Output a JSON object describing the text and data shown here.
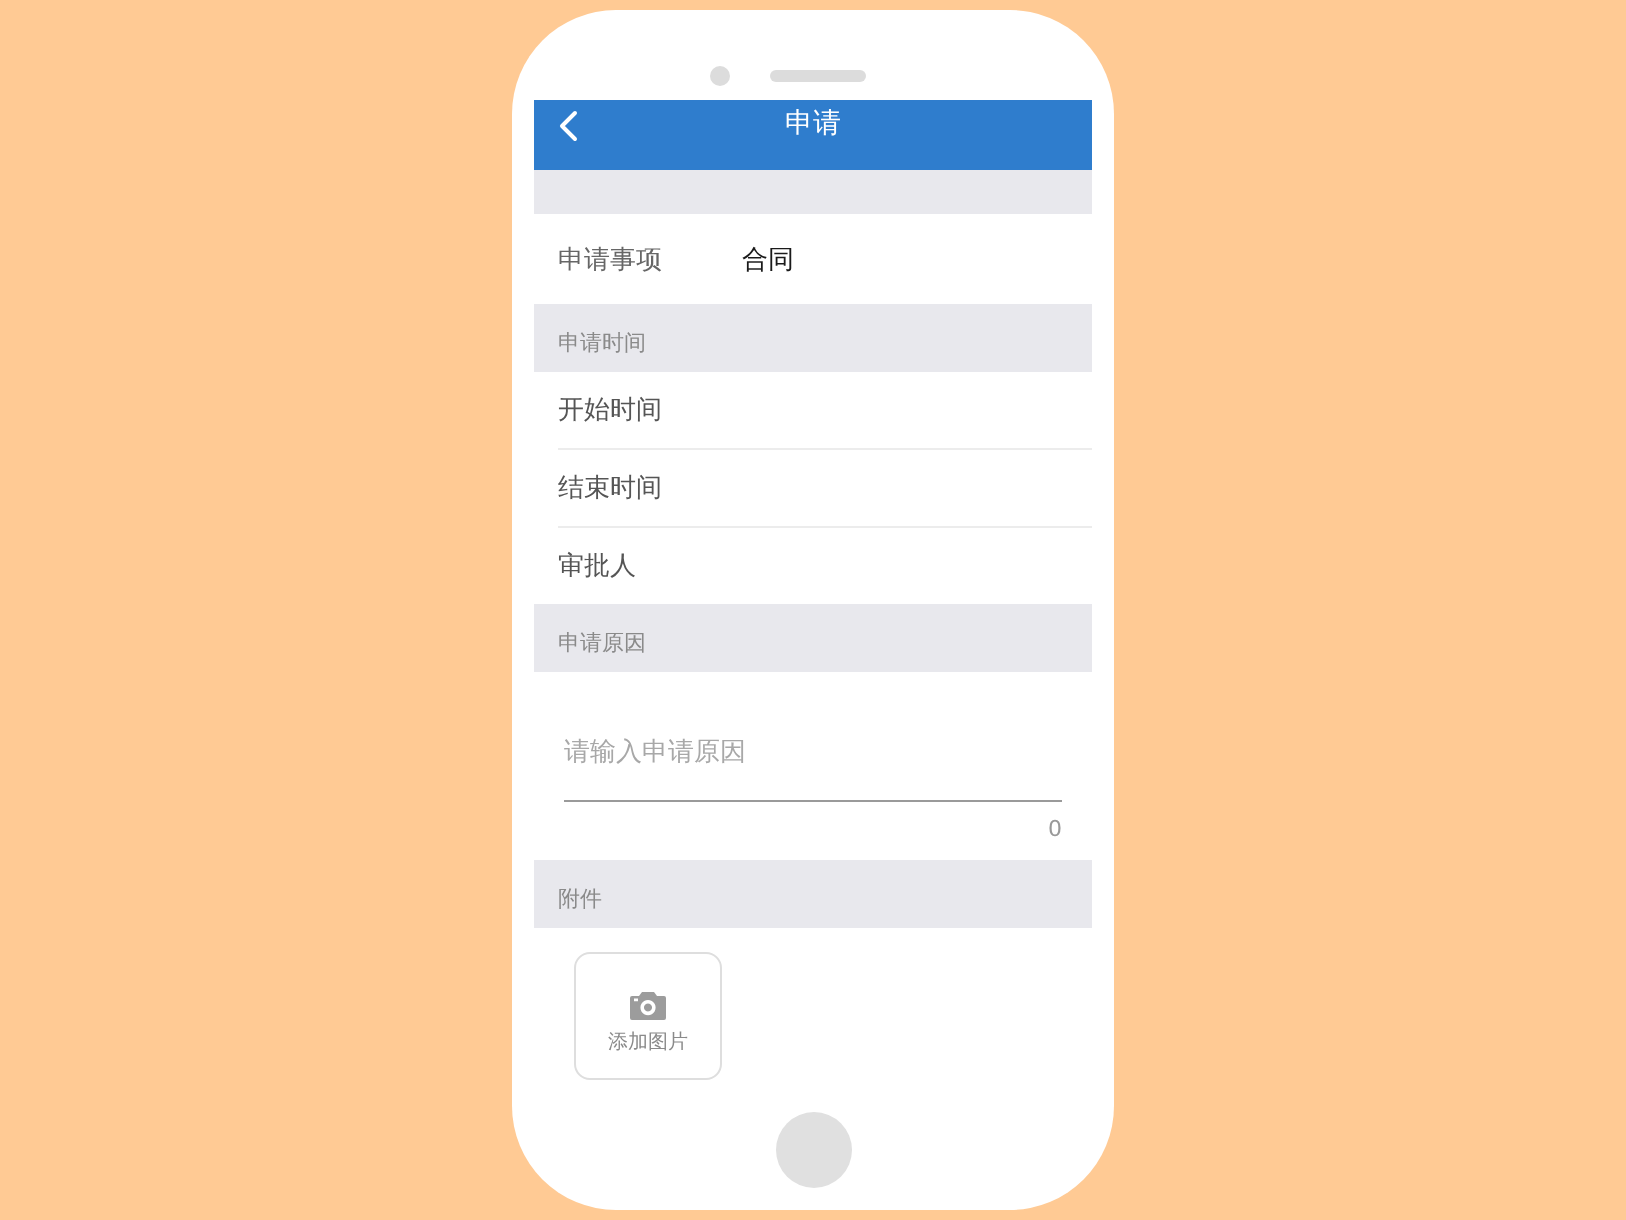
{
  "header": {
    "title": "申请"
  },
  "summary_row": {
    "label": "申请事项",
    "value": "合同"
  },
  "sections": [
    {
      "kind": "rows",
      "title": "申请时间",
      "rows": [
        {
          "label": "开始时间"
        },
        {
          "label": "结束时间"
        },
        {
          "label": "审批人"
        }
      ]
    },
    {
      "kind": "textarea",
      "title": "申请原因",
      "placeholder": "请输入申请原因",
      "counter": "0"
    },
    {
      "kind": "upload",
      "title": "附件",
      "button_label": "添加图片"
    }
  ]
}
